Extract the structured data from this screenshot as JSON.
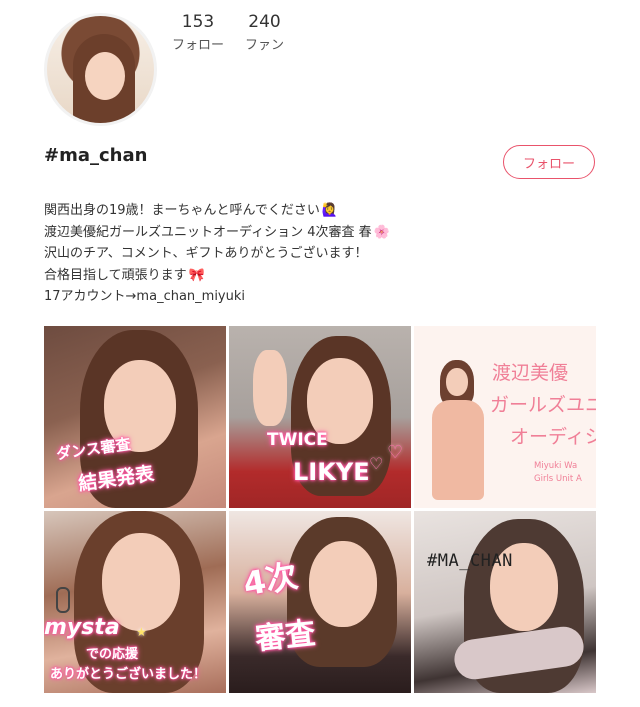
{
  "profile": {
    "follow_count": "153",
    "follow_label": "フォロー",
    "fan_count": "240",
    "fan_label": "ファン",
    "username": "#ma_chan",
    "follow_button": "フォロー"
  },
  "bio": {
    "line1": "関西出身の19歳！まーちゃんと呼んでください",
    "line1_emoji": "🙋‍♀️",
    "line2": "渡辺美優紀ガールズユニットオーディション 4次審査 春",
    "line2_emoji": "🌸",
    "line3": "沢山のチア、コメント、ギフトありがとうございます！",
    "line4": "合格目指して頑張ります",
    "line4_emoji": "🎀",
    "line5": "17アカウント→ma_chan_miyuki"
  },
  "posts": [
    {
      "overlay_line1": "ダンス審査",
      "overlay_line2": "結果発表"
    },
    {
      "overlay_line1": "TWICE",
      "overlay_line2": "LIKYE"
    },
    {
      "title_line1": "渡辺美優",
      "title_line2": "ガールズユニ",
      "title_line3": "オーディシ",
      "sub_line1": "Miyuki Wa",
      "sub_line2": "Girls Unit A"
    },
    {
      "overlay_line1": "mysta",
      "overlay_line2": "での応援",
      "overlay_line3": "ありがとうございました！"
    },
    {
      "overlay_line1": "4次",
      "overlay_line2": "審査"
    },
    {
      "tag": "#MA_CHAN"
    }
  ],
  "colors": {
    "accent": "#e9536b",
    "overlay_pink": "#ff5fa8"
  }
}
